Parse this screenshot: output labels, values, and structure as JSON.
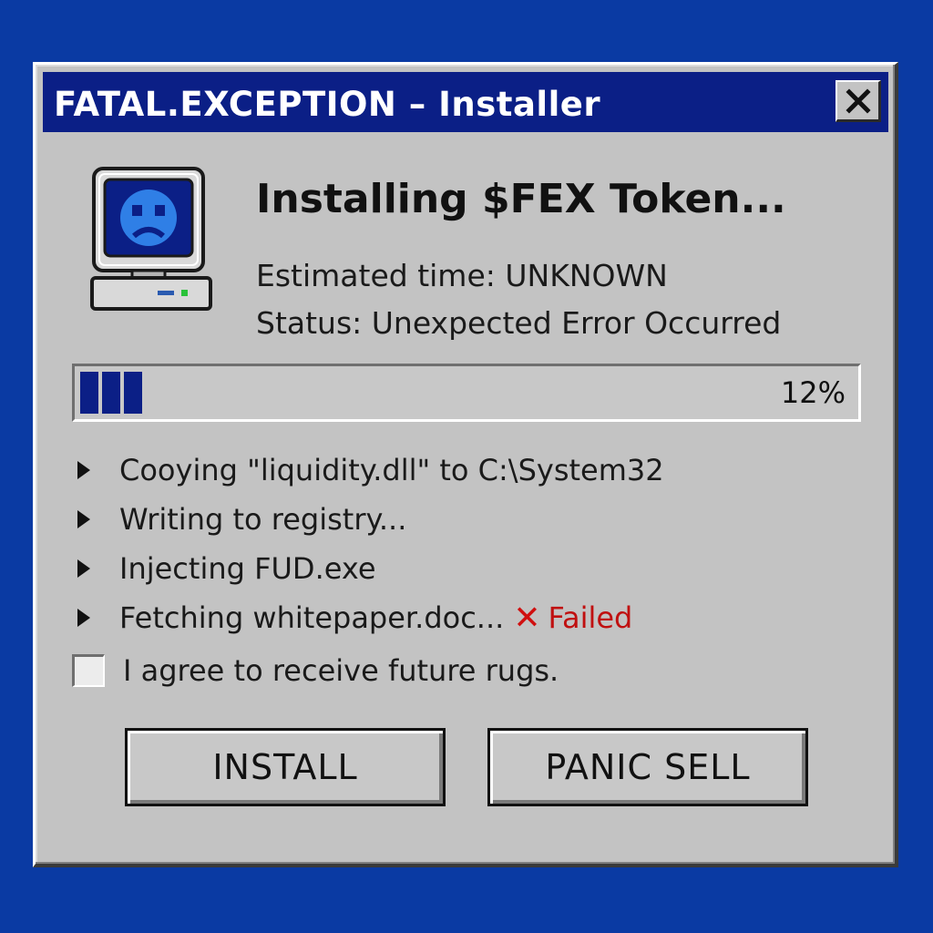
{
  "window": {
    "title": "FATAL.EXCEPTION – Installer",
    "close_icon": "close-icon"
  },
  "header": {
    "icon": "sad-computer-icon",
    "heading": "Installing $FEX Token...",
    "eta": "Estimated time: UNKNOWN",
    "status": "Status: Unexpected Error Occurred"
  },
  "progress": {
    "percent_label": "12%",
    "value": 0.12
  },
  "log": {
    "items": [
      {
        "text": "Cooying \"liquidity.dll\" to C:\\System32"
      },
      {
        "text": "Writing to registry..."
      },
      {
        "text": "Injecting FUD.exe"
      },
      {
        "text": "Fetching whitepaper.doc...",
        "fail_mark": "✕",
        "fail_label": "Failed"
      }
    ]
  },
  "agreement": {
    "label": "I agree to receive future rugs.",
    "checked": false
  },
  "buttons": {
    "install": "INSTALL",
    "panic_sell": "PANIC SELL"
  },
  "colors": {
    "desktop": "#0a3aa3",
    "titlebar": "#0b1f86",
    "window": "#c3c3c3",
    "error": "#d01010"
  }
}
